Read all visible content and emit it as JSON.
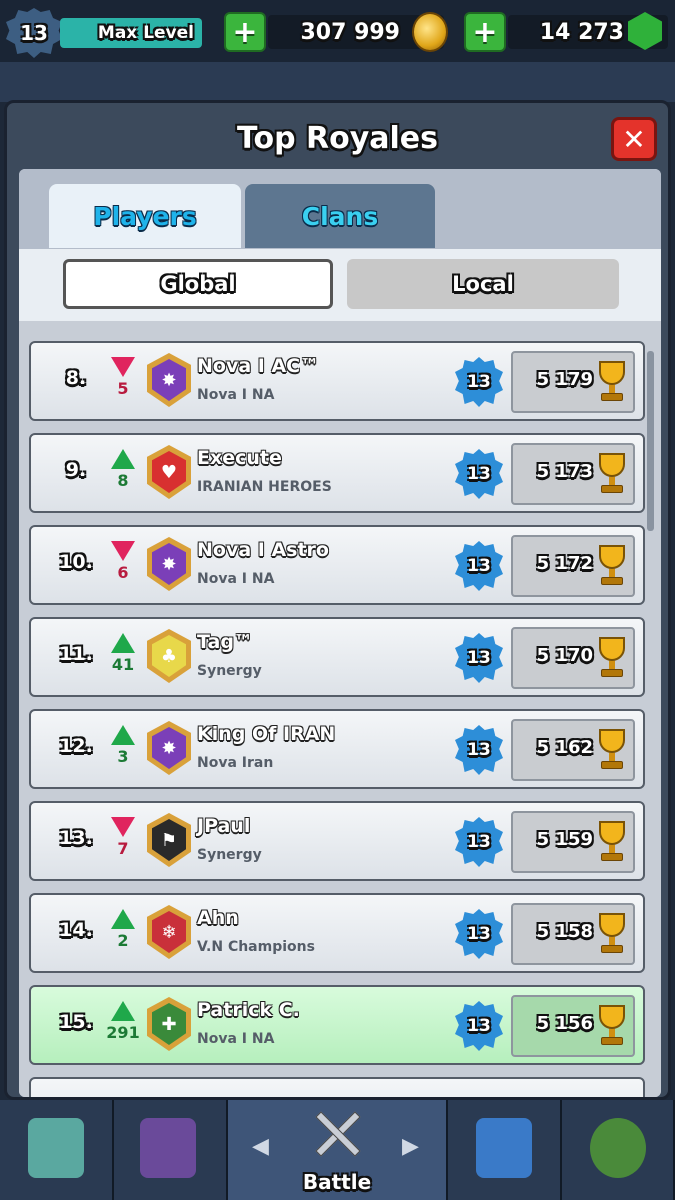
{
  "topbar": {
    "level": "13",
    "max_level_label": "Max Level",
    "gold": "307 999",
    "gems": "14 273",
    "add_gold_label": "+",
    "add_gems_label": "+"
  },
  "modal": {
    "title": "Top Royales",
    "close_label": "✕",
    "tabs": [
      {
        "label": "Players",
        "active": true
      },
      {
        "label": "Clans",
        "active": false
      }
    ],
    "subtabs": [
      {
        "label": "Global",
        "active": true
      },
      {
        "label": "Local",
        "active": false
      }
    ]
  },
  "players": [
    {
      "rank": "8.",
      "direction": "down",
      "change": "5",
      "name": "Nova I AC™",
      "clan": "Nova I NA",
      "level": "13",
      "trophies": "5 179",
      "badge_color": "#7b3fb8",
      "badge_symbol": "✸"
    },
    {
      "rank": "9.",
      "direction": "up",
      "change": "8",
      "name": "Execute",
      "clan": "IRANIAN HEROES",
      "level": "13",
      "trophies": "5 173",
      "badge_color": "#d83030",
      "badge_symbol": "♥"
    },
    {
      "rank": "10.",
      "direction": "down",
      "change": "6",
      "name": "Nova I Astro",
      "clan": "Nova I NA",
      "level": "13",
      "trophies": "5 172",
      "badge_color": "#7b3fb8",
      "badge_symbol": "✸"
    },
    {
      "rank": "11.",
      "direction": "up",
      "change": "41",
      "name": "Tag™",
      "clan": "Synergy",
      "level": "13",
      "trophies": "5 170",
      "badge_color": "#e8d84a",
      "badge_symbol": "♣"
    },
    {
      "rank": "12.",
      "direction": "up",
      "change": "3",
      "name": "King Of IRAN",
      "clan": "Nova Iran",
      "level": "13",
      "trophies": "5 162",
      "badge_color": "#7b3fb8",
      "badge_symbol": "✸"
    },
    {
      "rank": "13.",
      "direction": "down",
      "change": "7",
      "name": "JPaul",
      "clan": "Synergy",
      "level": "13",
      "trophies": "5 159",
      "badge_color": "#2a2a2a",
      "badge_symbol": "⚑"
    },
    {
      "rank": "14.",
      "direction": "up",
      "change": "2",
      "name": "Ahn",
      "clan": "V.N Champions",
      "level": "13",
      "trophies": "5 158",
      "badge_color": "#c9303a",
      "badge_symbol": "❄"
    },
    {
      "rank": "15.",
      "direction": "up",
      "change": "291",
      "name": "Patrick C.",
      "clan": "Nova I NA",
      "level": "13",
      "trophies": "5 156",
      "badge_color": "#3a8a3a",
      "badge_symbol": "✚",
      "is_me": true
    }
  ],
  "bottom_nav": {
    "battle_label": "Battle",
    "left_arrow": "◀",
    "right_arrow": "▶"
  }
}
